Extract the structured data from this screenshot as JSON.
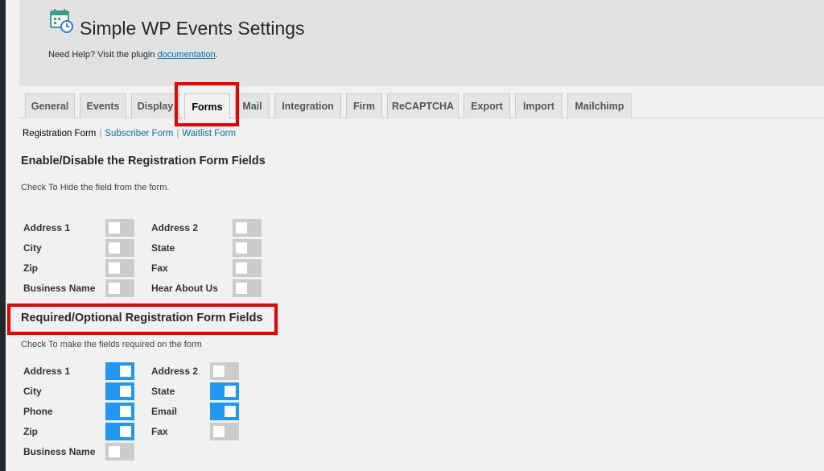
{
  "header": {
    "title": "Simple WP Events Settings",
    "help_prefix": "Need Help? Visit the plugin ",
    "help_link": "documentation",
    "help_suffix": "."
  },
  "tabs": [
    {
      "label": "General"
    },
    {
      "label": "Events"
    },
    {
      "label": "Display"
    },
    {
      "label": "Forms",
      "active": true
    },
    {
      "label": "Mail"
    },
    {
      "label": "Integration"
    },
    {
      "label": "Firm"
    },
    {
      "label": "ReCAPTCHA"
    },
    {
      "label": "Export"
    },
    {
      "label": "Import"
    },
    {
      "label": "Mailchimp"
    }
  ],
  "subnav": {
    "current": "Registration Form",
    "sep": "|",
    "links": [
      "Subscriber Form",
      "Waitlist Form"
    ]
  },
  "enable_section": {
    "title": "Enable/Disable the Registration Form Fields",
    "desc": "Check To Hide the field from the form.",
    "fields": [
      {
        "label": "Address 1",
        "checked": false
      },
      {
        "label": "Address 2",
        "checked": false
      },
      {
        "label": "City",
        "checked": false
      },
      {
        "label": "State",
        "checked": false
      },
      {
        "label": "Zip",
        "checked": false
      },
      {
        "label": "Fax",
        "checked": false
      },
      {
        "label": "Business Name",
        "checked": false
      },
      {
        "label": "Hear About Us",
        "checked": false
      }
    ]
  },
  "required_section": {
    "title": "Required/Optional Registration Form Fields",
    "desc": "Check To make the fields required on the form",
    "fields": [
      {
        "label": "Address 1",
        "checked": true
      },
      {
        "label": "Address 2",
        "checked": false
      },
      {
        "label": "City",
        "checked": true
      },
      {
        "label": "State",
        "checked": true
      },
      {
        "label": "Phone",
        "checked": true
      },
      {
        "label": "Email",
        "checked": true
      },
      {
        "label": "Zip",
        "checked": true
      },
      {
        "label": "Fax",
        "checked": false
      },
      {
        "label": "Business Name",
        "checked": false
      }
    ]
  },
  "colors": {
    "toggle_on": "#2196f3",
    "toggle_off": "#cccccc",
    "highlight": "#ee0000",
    "link": "#0073aa"
  },
  "icons": {
    "logo": "calendar-clock-icon"
  }
}
